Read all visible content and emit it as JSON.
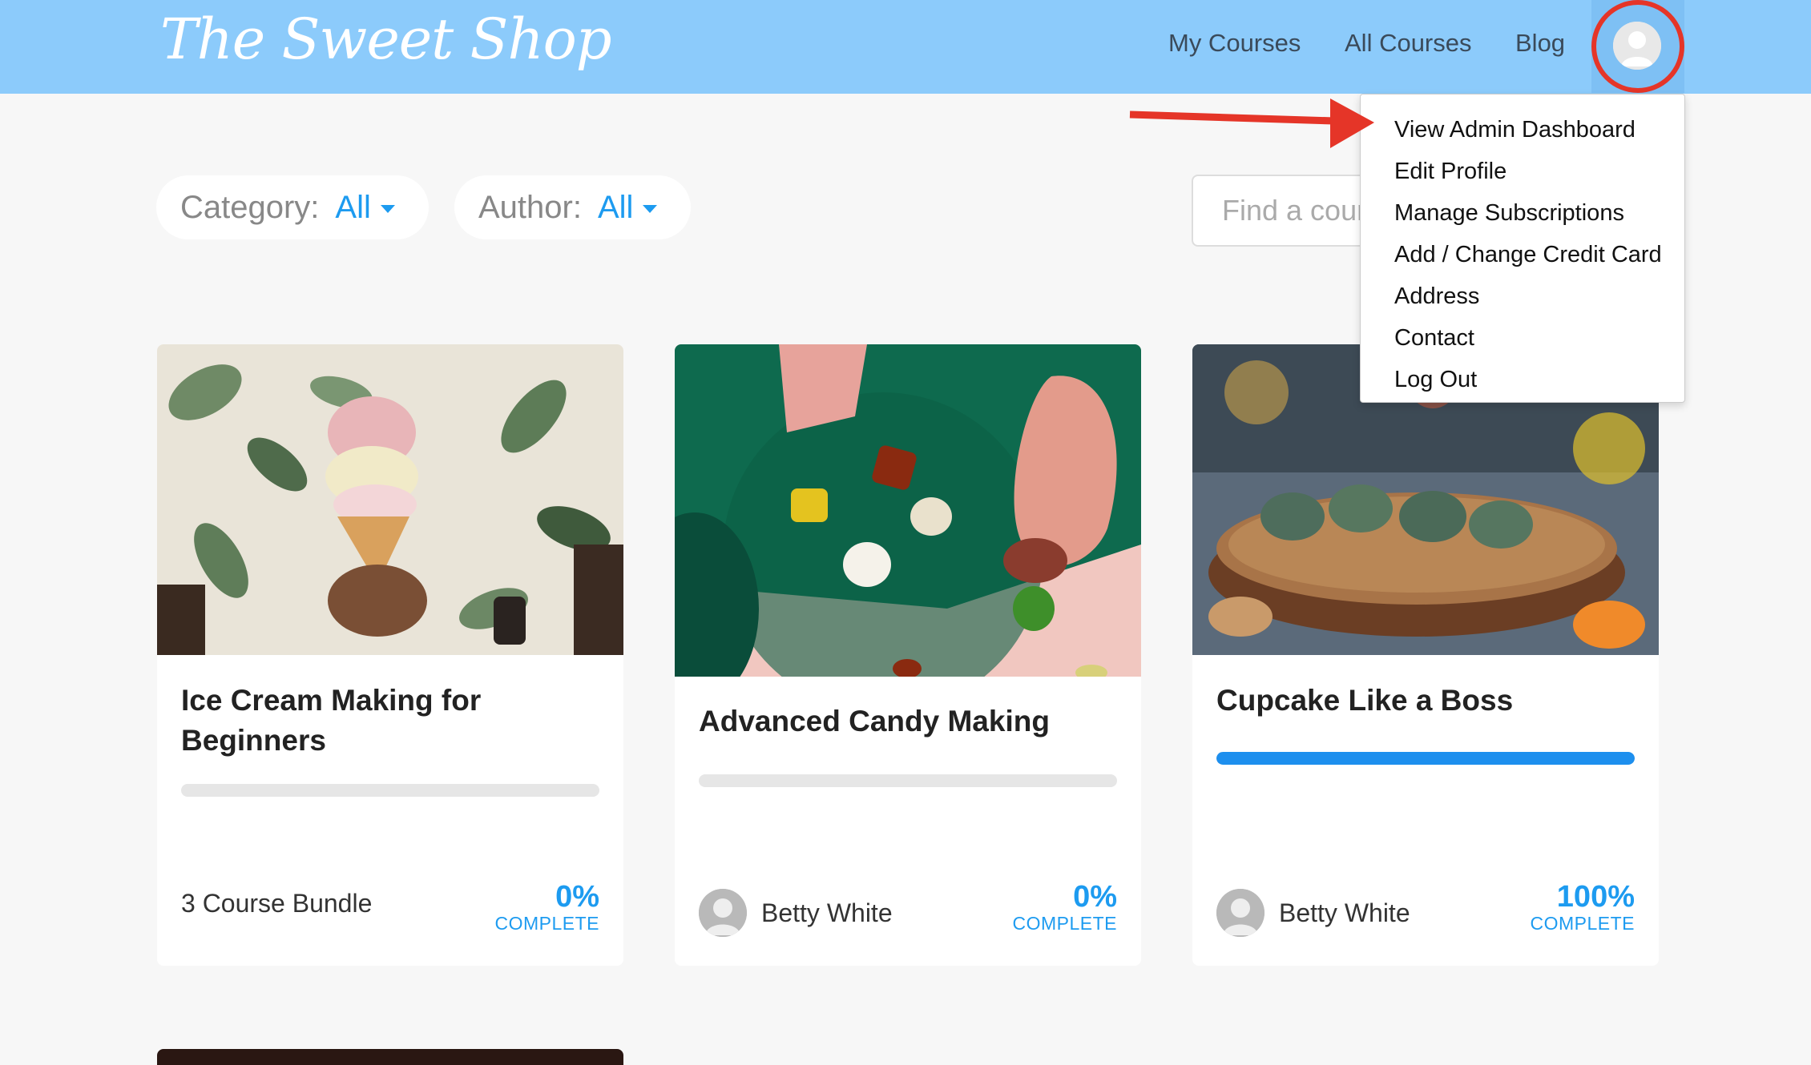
{
  "header": {
    "logo": "The Sweet Shop",
    "nav": {
      "my_courses": "My Courses",
      "all_courses": "All Courses",
      "blog": "Blog"
    }
  },
  "filters": {
    "category_label": "Category:",
    "category_value": "All",
    "author_label": "Author:",
    "author_value": "All",
    "search_placeholder": "Find a course"
  },
  "dropdown": {
    "items": [
      "View Admin Dashboard",
      "Edit Profile",
      "Manage Subscriptions",
      "Add / Change Credit Card",
      "Address",
      "Contact",
      "Log Out"
    ]
  },
  "courses": [
    {
      "title": "Ice Cream Making for Beginners",
      "footer_text": "3 Course Bundle",
      "progress": 0,
      "percent": "0%",
      "complete_label": "COMPLETE"
    },
    {
      "title": "Advanced Candy Making",
      "footer_text": "Betty White",
      "progress": 0,
      "percent": "0%",
      "complete_label": "COMPLETE"
    },
    {
      "title": "Cupcake Like a Boss",
      "footer_text": "Betty White",
      "progress": 1,
      "percent": "100%",
      "complete_label": "COMPLETE"
    }
  ],
  "colors": {
    "header_bg": "#8ccbfb",
    "accent": "#1d9bf0",
    "annotation": "#e53528"
  },
  "icons": {
    "user_avatar": "user-silhouette-icon",
    "caret": "caret-down-icon"
  }
}
